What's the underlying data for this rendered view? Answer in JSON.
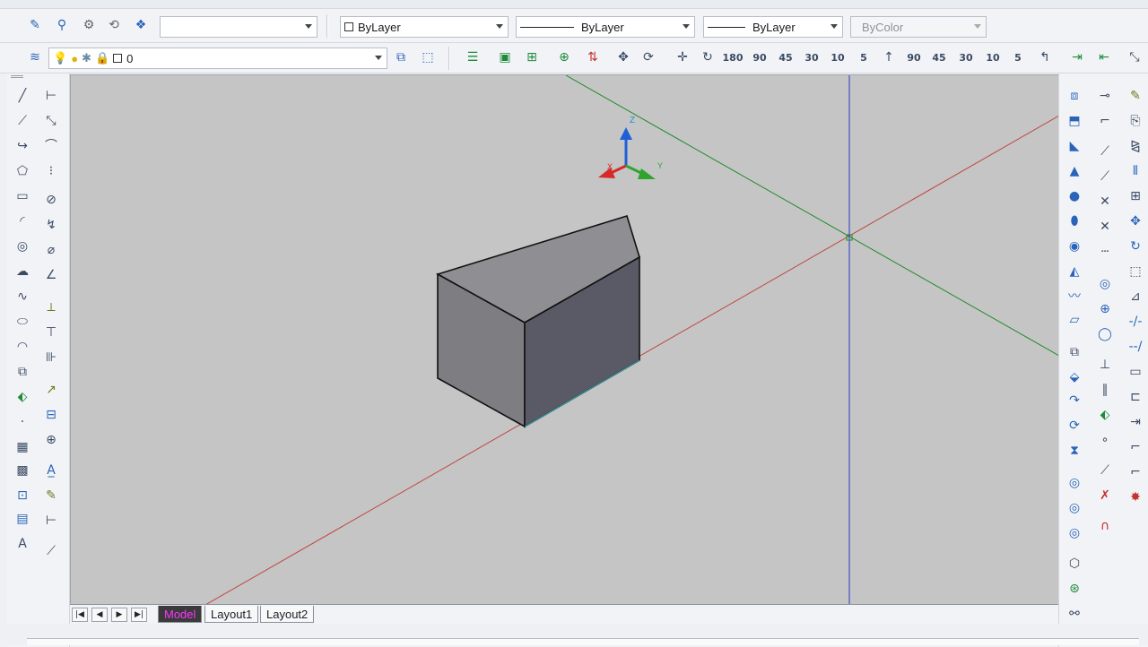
{
  "properties": {
    "layer_value": "",
    "color_value": "ByLayer",
    "linetype_value": "ByLayer",
    "lineweight_value": "ByLayer",
    "plotstyle_value": "ByColor"
  },
  "layers": {
    "current_layer": "0"
  },
  "tabs": {
    "model": "Model",
    "layout1": "Layout1",
    "layout2": "Layout2",
    "active": "Model"
  },
  "ucs_icon": {
    "x_label": "X",
    "y_label": "Y",
    "z_label": "Z"
  },
  "view_rotate_buttons": [
    "180",
    "90",
    "45",
    "30",
    "10",
    "5",
    "90",
    "45",
    "30",
    "10",
    "5"
  ],
  "colors": {
    "viewport_bg": "#c5c5c5",
    "x_axis": "#c0473d",
    "y_axis": "#1f8a2a",
    "z_axis": "#2d36c8",
    "box_top": "#8f8f93",
    "box_left": "#7d7d82",
    "box_right": "#595a66",
    "active_tab_text": "#ff33ff"
  }
}
